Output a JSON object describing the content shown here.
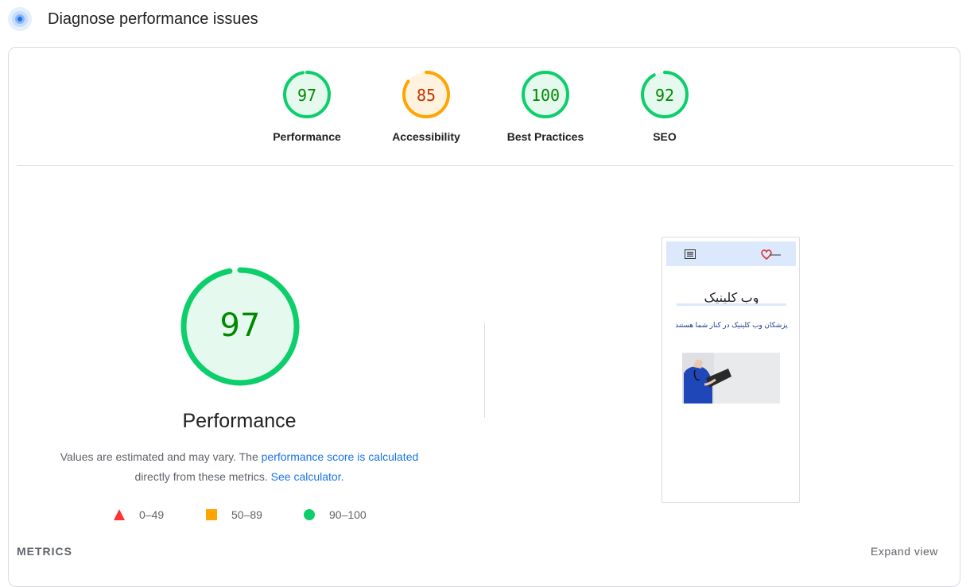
{
  "header": {
    "title": "Diagnose performance issues",
    "icon": "lighthouse-icon"
  },
  "gauges": [
    {
      "label": "Performance",
      "score": 97,
      "color": "#0cce6b",
      "fill": "#e6f9ee",
      "text_color": "#008800"
    },
    {
      "label": "Accessibility",
      "score": 85,
      "color": "#ffa400",
      "fill": "#fff3e0",
      "text_color": "#c33300"
    },
    {
      "label": "Best Practices",
      "score": 100,
      "color": "#0cce6b",
      "fill": "#e6f9ee",
      "text_color": "#008800"
    },
    {
      "label": "SEO",
      "score": 92,
      "color": "#0cce6b",
      "fill": "#e6f9ee",
      "text_color": "#008800"
    }
  ],
  "performance": {
    "score": 97,
    "label": "Performance",
    "desc_1": "Values are estimated and may vary. The ",
    "link_1": "performance score is calculated",
    "desc_2": "directly from these metrics. ",
    "link_2": "See calculator."
  },
  "legend": [
    {
      "shape": "triangle",
      "range": "0–49",
      "color": "#ff3333"
    },
    {
      "shape": "square",
      "range": "50–89",
      "color": "#ffa400"
    },
    {
      "shape": "circle",
      "range": "90–100",
      "color": "#0cce6b"
    }
  ],
  "screenshot": {
    "title": "وب کلینیک",
    "subtitle": "پزشکان وب کلینیک در کنار شما هستند"
  },
  "metrics": {
    "label": "METRICS",
    "expand": "Expand view"
  }
}
